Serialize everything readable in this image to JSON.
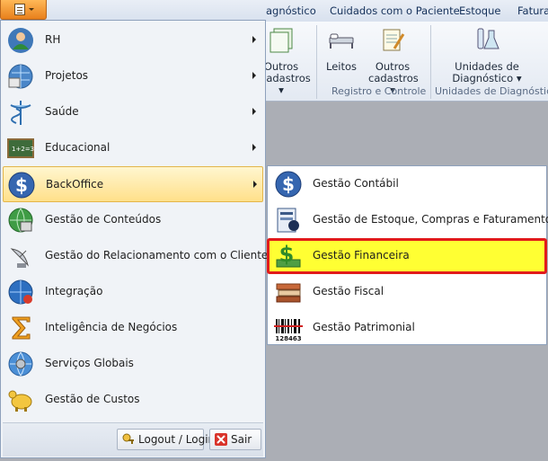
{
  "ribbon": {
    "tabs": [
      "agnóstico",
      "Cuidados com o Paciente",
      "Estoque",
      "Fatura"
    ],
    "buttons": {
      "outros_cadastros_1": [
        "Outros",
        "cadastros"
      ],
      "leitos": "Leitos",
      "outros_cadastros_2": [
        "Outros",
        "cadastros"
      ],
      "unidades": [
        "Unidades de",
        "Diagnóstico"
      ]
    },
    "groups": [
      "Registro e Controle",
      "Unidades de Diagnóstico"
    ]
  },
  "menu": {
    "items": [
      {
        "label": "RH",
        "icon": "user-icon",
        "submenu": true
      },
      {
        "label": "Projetos",
        "icon": "globe-project-icon",
        "submenu": true
      },
      {
        "label": "Saúde",
        "icon": "caduceus-icon",
        "submenu": true
      },
      {
        "label": "Educacional",
        "icon": "chalkboard-icon",
        "submenu": true
      },
      {
        "label": "BackOffice",
        "icon": "dollar-icon",
        "submenu": true,
        "highlighted": true
      },
      {
        "label": "Gestão de Conteúdos",
        "icon": "content-globe-icon",
        "submenu": false
      },
      {
        "label": "Gestão do Relacionamento com o Cliente",
        "icon": "satellite-dish-icon",
        "submenu": false
      },
      {
        "label": "Integração",
        "icon": "integration-globe-icon",
        "submenu": false
      },
      {
        "label": "Inteligência de Negócios",
        "icon": "sigma-icon",
        "submenu": false
      },
      {
        "label": "Serviços Globais",
        "icon": "globe-gear-icon",
        "submenu": false
      },
      {
        "label": "Gestão de Custos",
        "icon": "piggy-bank-icon",
        "submenu": false
      }
    ],
    "footer": {
      "logout": "Logout / Login",
      "exit": "Sair"
    }
  },
  "submenu": {
    "items": [
      {
        "label": "Gestão Contábil",
        "icon": "dollar-icon"
      },
      {
        "label": "Gestão de Estoque, Compras e Faturamento",
        "icon": "inventory-icon"
      },
      {
        "label": "Gestão Financeira",
        "icon": "money-icon",
        "selected": true
      },
      {
        "label": "Gestão Fiscal",
        "icon": "books-icon"
      },
      {
        "label": "Gestão Patrimonial",
        "icon": "barcode-icon",
        "barcode_number": "128463"
      }
    ]
  },
  "colors": {
    "highlight": "#ffe08a",
    "selected_fill": "#ffff33",
    "selected_border": "#e11b1b"
  }
}
